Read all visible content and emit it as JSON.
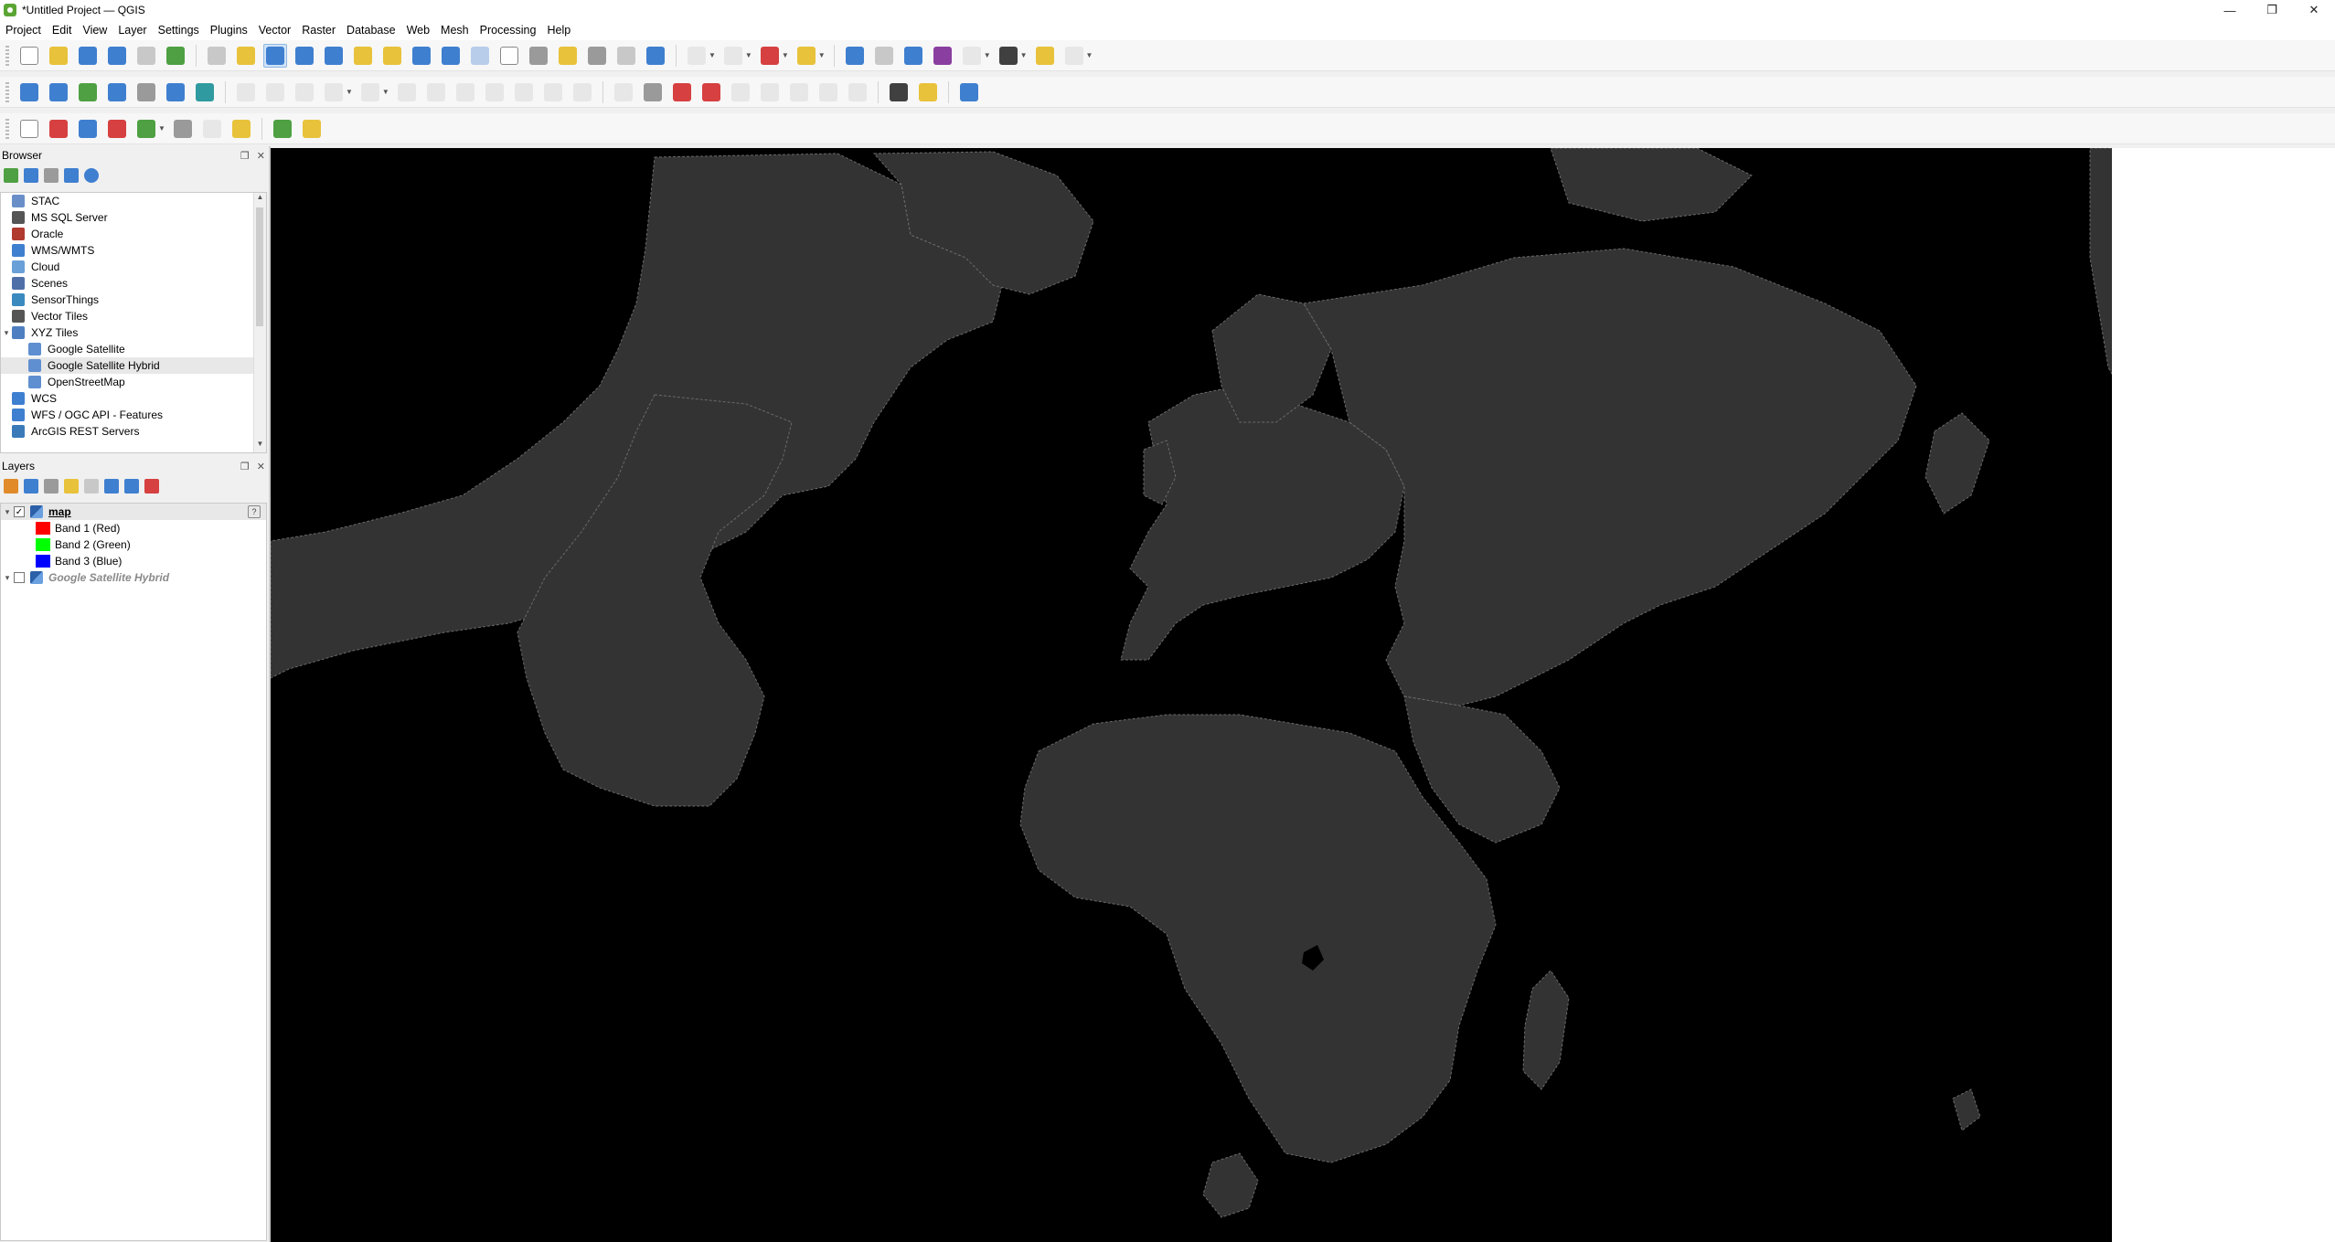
{
  "window": {
    "title": "*Untitled Project — QGIS",
    "controls": {
      "minimize": "—",
      "restore": "❐",
      "close": "✕"
    }
  },
  "menu": [
    "Project",
    "Edit",
    "View",
    "Layer",
    "Settings",
    "Plugins",
    "Vector",
    "Raster",
    "Database",
    "Web",
    "Mesh",
    "Processing",
    "Help"
  ],
  "browser": {
    "title": "Browser",
    "items": [
      {
        "label": "STAC",
        "icon": "stac-icon",
        "indent": 0,
        "expander": ""
      },
      {
        "label": "MS SQL Server",
        "icon": "mssql-icon",
        "indent": 0,
        "expander": ""
      },
      {
        "label": "Oracle",
        "icon": "oracle-icon",
        "indent": 0,
        "expander": ""
      },
      {
        "label": "WMS/WMTS",
        "icon": "wms-icon",
        "indent": 0,
        "expander": ""
      },
      {
        "label": "Cloud",
        "icon": "cloud-icon",
        "indent": 0,
        "expander": ""
      },
      {
        "label": "Scenes",
        "icon": "scenes-icon",
        "indent": 0,
        "expander": ""
      },
      {
        "label": "SensorThings",
        "icon": "sensorthings-icon",
        "indent": 0,
        "expander": ""
      },
      {
        "label": "Vector Tiles",
        "icon": "vector-tiles-icon",
        "indent": 0,
        "expander": ""
      },
      {
        "label": "XYZ Tiles",
        "icon": "xyz-tiles-icon",
        "indent": 0,
        "expander": "▾"
      },
      {
        "label": "Google Satellite",
        "icon": "tile-grid-icon",
        "indent": 1,
        "expander": ""
      },
      {
        "label": "Google Satellite Hybrid",
        "icon": "tile-grid-icon",
        "indent": 1,
        "expander": "",
        "selected": true
      },
      {
        "label": "OpenStreetMap",
        "icon": "tile-grid-icon",
        "indent": 1,
        "expander": ""
      },
      {
        "label": "WCS",
        "icon": "wcs-icon",
        "indent": 0,
        "expander": ""
      },
      {
        "label": "WFS / OGC API - Features",
        "icon": "wfs-icon",
        "indent": 0,
        "expander": ""
      },
      {
        "label": "ArcGIS REST Servers",
        "icon": "arcgis-icon",
        "indent": 0,
        "expander": ""
      }
    ]
  },
  "layers": {
    "title": "Layers",
    "map_layer": {
      "name": "map",
      "checked": "✓",
      "help": "?"
    },
    "bands": [
      {
        "label": "Band 1 (Red)",
        "color": "#ff0000"
      },
      {
        "label": "Band 2 (Green)",
        "color": "#00ff00"
      },
      {
        "label": "Band 3 (Blue)",
        "color": "#0000ff"
      }
    ],
    "hybrid_layer": {
      "name": "Google Satellite Hybrid"
    }
  },
  "map": {
    "background": "#000000",
    "land_color": "#333333",
    "border_color": "#6a6a6a"
  }
}
